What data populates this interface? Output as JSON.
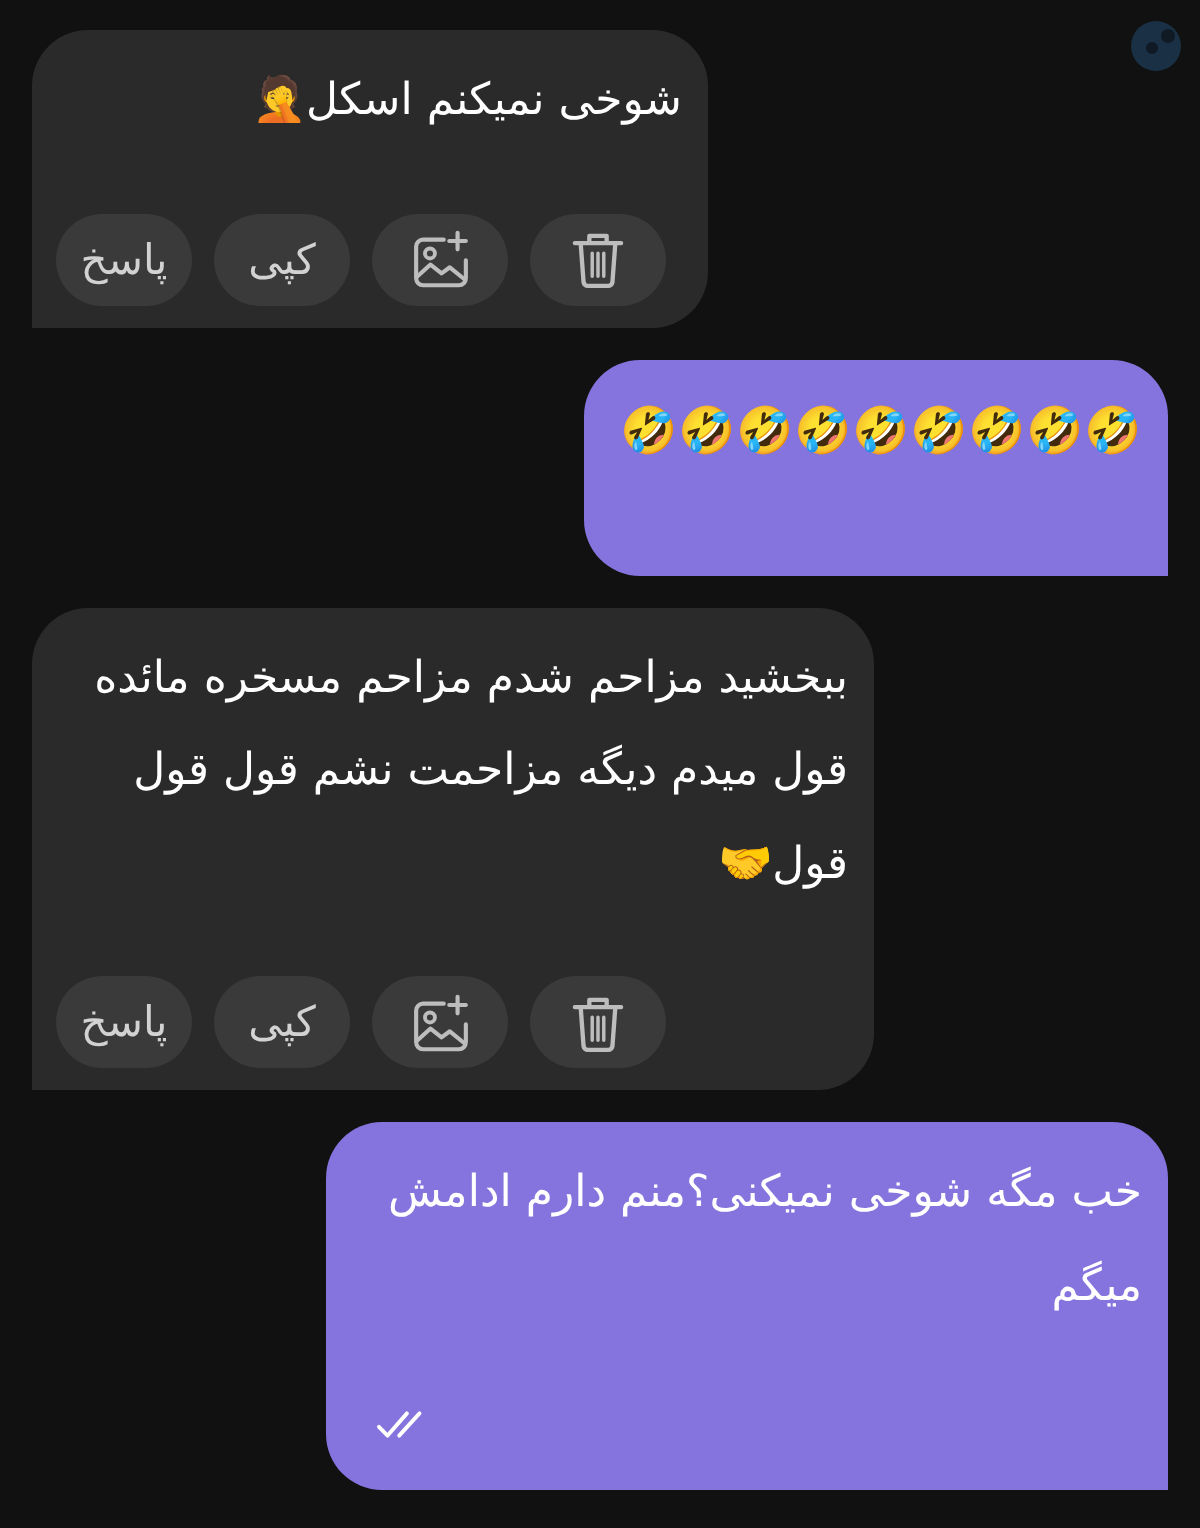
{
  "messages": [
    {
      "kind": "received",
      "text": "شوخی نمیکنم اسکل🤦",
      "actions": [
        {
          "kind": "delete"
        },
        {
          "kind": "gallery"
        },
        {
          "kind": "copy",
          "label": "کپی"
        },
        {
          "kind": "reply",
          "label": "پاسخ"
        }
      ]
    },
    {
      "kind": "sent",
      "text": "🤣🤣🤣🤣🤣🤣🤣🤣🤣"
    },
    {
      "kind": "received",
      "text": "ببخشید مزاحم شدم مزاحم مسخره مائده قول میدم دیگه مزاحمت نشم قول قول قول🤝",
      "actions": [
        {
          "kind": "delete"
        },
        {
          "kind": "gallery"
        },
        {
          "kind": "copy",
          "label": "کپی"
        },
        {
          "kind": "reply",
          "label": "پاسخ"
        }
      ]
    },
    {
      "kind": "sent",
      "text": "خب مگه شوخی نمیکنی؟منم دارم ادامش میگم",
      "read": true
    }
  ]
}
